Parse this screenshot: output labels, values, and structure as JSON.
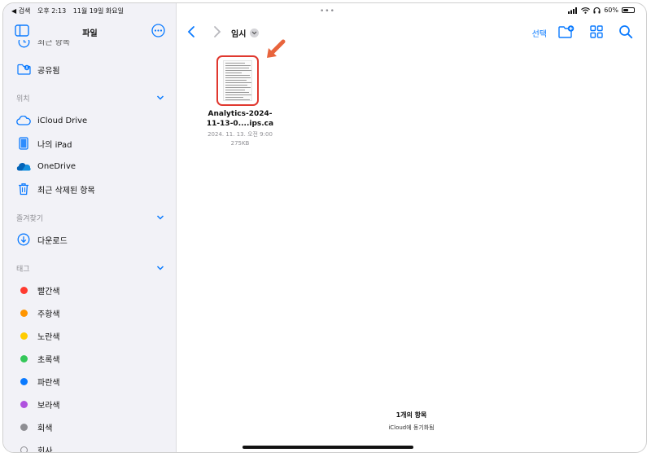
{
  "status_bar": {
    "back_app": "◀ 검색",
    "time": "오후 2:13",
    "date": "11월 19일 화요일",
    "battery": "60%",
    "battery_level": 0.6
  },
  "sidebar": {
    "title": "파일",
    "partial_item": "최근 항목",
    "shared": "공유됨",
    "locations_header": "위치",
    "locations": [
      "iCloud Drive",
      "나의 iPad",
      "OneDrive",
      "최근 삭제된 항목"
    ],
    "favorites_header": "즐겨찾기",
    "favorites": [
      "다운로드"
    ],
    "tags_header": "태그",
    "tags": [
      {
        "label": "빨간색",
        "color": "#ff3b30"
      },
      {
        "label": "주황색",
        "color": "#ff9500"
      },
      {
        "label": "노란색",
        "color": "#ffcc00"
      },
      {
        "label": "초록색",
        "color": "#34c759"
      },
      {
        "label": "파란색",
        "color": "#0a7aff"
      },
      {
        "label": "보라색",
        "color": "#af52de"
      },
      {
        "label": "회색",
        "color": "#8e8e93"
      },
      {
        "label": "회사",
        "color": ""
      }
    ]
  },
  "main": {
    "folder_title": "임시",
    "select_label": "선택",
    "file": {
      "name_line1": "Analytics-2024-",
      "name_line2": "11-13-0....ips.ca",
      "date": "2024. 11. 13. 오전 9:00",
      "size": "275KB"
    },
    "item_count": "1개의 항목",
    "sync_status": "iCloud에 동기화됨"
  },
  "colors": {
    "accent": "#0a7aff",
    "highlight": "#e0382f",
    "arrow": "#e8643c"
  }
}
